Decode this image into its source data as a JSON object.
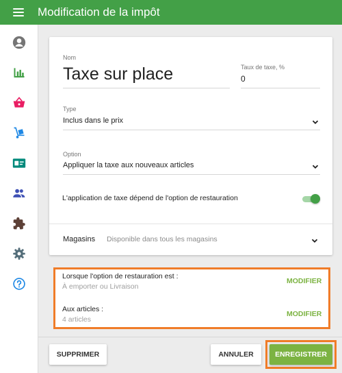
{
  "header": {
    "title": "Modification de la impôt"
  },
  "sidebar": {
    "items": [
      {
        "icon": "account-circle-icon",
        "color": "#757575"
      },
      {
        "icon": "bar-chart-icon",
        "color": "#43a047"
      },
      {
        "icon": "basket-icon",
        "color": "#e91e63"
      },
      {
        "icon": "hand-truck-icon",
        "color": "#1e88e5"
      },
      {
        "icon": "contact-card-icon",
        "color": "#00897b"
      },
      {
        "icon": "people-icon",
        "color": "#3f51b5"
      },
      {
        "icon": "puzzle-icon",
        "color": "#5d4037"
      },
      {
        "icon": "settings-icon",
        "color": "#546e7a"
      },
      {
        "icon": "help-icon",
        "color": "#1e88e5"
      }
    ]
  },
  "form": {
    "name_label": "Nom",
    "name_value": "Taxe sur place",
    "rate_label": "Taux de taxe, %",
    "rate_value": "0",
    "type_label": "Type",
    "type_value": "Inclus dans le prix",
    "option_label": "Option",
    "option_value": "Appliquer la taxe aux nouveaux articles",
    "toggle_label": "L'application de taxe dépend de l'option de restauration",
    "toggle_on": true,
    "stores_label": "Magasins",
    "stores_value": "Disponible dans tous les magasins"
  },
  "conditions": {
    "dining_title": "Lorsque l'option de restauration est :",
    "dining_value": "À emporter ou Livraison",
    "items_title": "Aux articles :",
    "items_value": "4 articles",
    "modify_label": "MODIFIER"
  },
  "buttons": {
    "delete": "SUPPRIMER",
    "cancel": "ANNULER",
    "save": "ENREGISTRER"
  },
  "colors": {
    "accent": "#43a047",
    "action_green": "#7cb342",
    "highlight": "#f07c28"
  }
}
